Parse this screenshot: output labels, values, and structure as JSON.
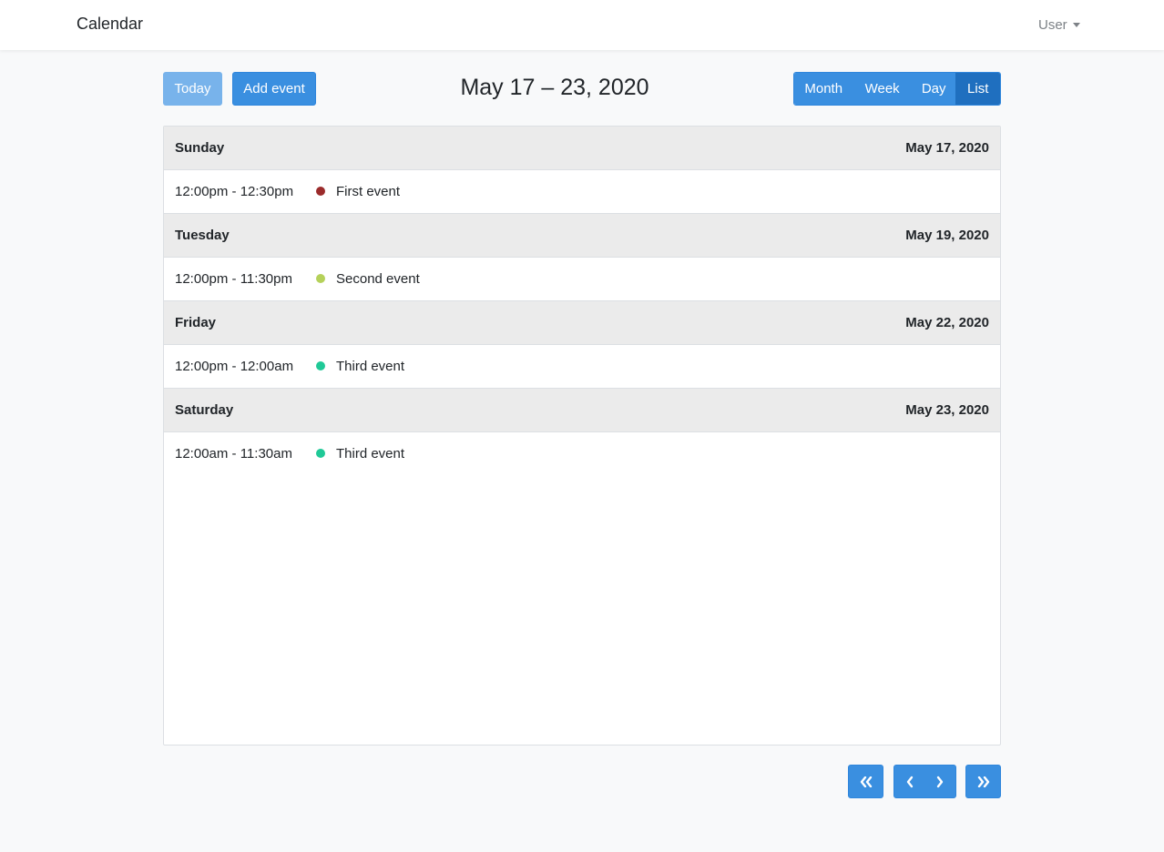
{
  "navbar": {
    "brand": "Calendar",
    "user_label": "User"
  },
  "toolbar": {
    "today_label": "Today",
    "add_event_label": "Add event",
    "range_title": "May 17 – 23, 2020",
    "views": {
      "month": "Month",
      "week": "Week",
      "day": "Day",
      "list": "List"
    },
    "active_view": "List"
  },
  "days": [
    {
      "name": "Sunday",
      "date": "May 17, 2020",
      "event": {
        "time": "12:00pm - 12:30pm",
        "title": "First event",
        "color": "#9b2b2b"
      }
    },
    {
      "name": "Tuesday",
      "date": "May 19, 2020",
      "event": {
        "time": "12:00pm - 11:30pm",
        "title": "Second event",
        "color": "#b5d15a"
      }
    },
    {
      "name": "Friday",
      "date": "May 22, 2020",
      "event": {
        "time": "12:00pm - 12:00am",
        "title": "Third event",
        "color": "#20c997"
      }
    },
    {
      "name": "Saturday",
      "date": "May 23, 2020",
      "event": {
        "time": "12:00am - 11:30am",
        "title": "Third event",
        "color": "#20c997"
      }
    }
  ],
  "pager": {
    "first_icon": "double-chevron-left-icon",
    "prev_icon": "chevron-left-icon",
    "next_icon": "chevron-right-icon",
    "last_icon": "double-chevron-right-icon"
  },
  "colors": {
    "primary": "#3a8fe0",
    "primary_active": "#1f6fbf",
    "today_disabled": "#78b3eb",
    "day_header_bg": "#ebebeb"
  }
}
